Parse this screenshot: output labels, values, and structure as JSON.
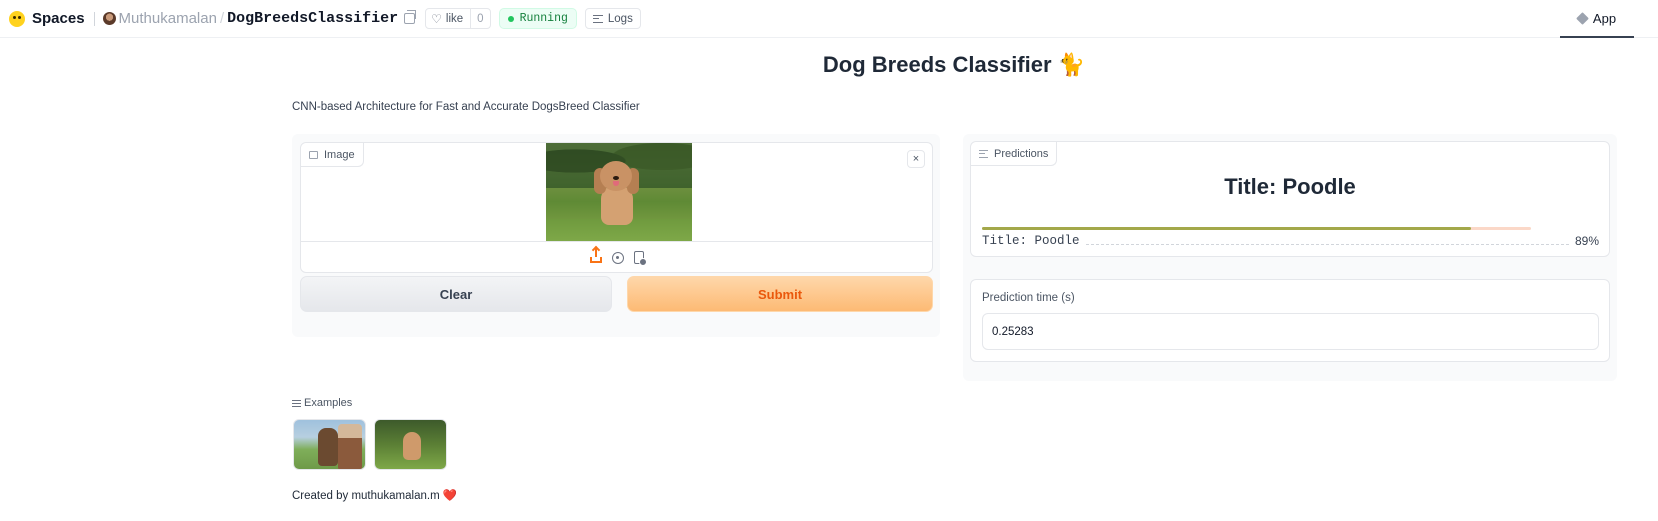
{
  "topbar": {
    "spaces_label": "Spaces",
    "owner": "Muthukamalan",
    "repo": "DogBreedsClassifier",
    "like_label": "like",
    "like_count": "0",
    "status": "Running",
    "logs_label": "Logs",
    "app_tab": "App"
  },
  "page": {
    "title": "Dog Breeds Classifier",
    "title_emoji": "🐈",
    "description": "CNN-based Architecture for Fast and Accurate DogsBreed Classifier"
  },
  "input": {
    "image_label": "Image",
    "clear_x": "×",
    "clear_button": "Clear",
    "submit_button": "Submit"
  },
  "output": {
    "predictions_label": "Predictions",
    "top_label": "Title: Poodle",
    "confidences": [
      {
        "label": "Title: Poodle",
        "value": 0.89,
        "display": "89%"
      }
    ],
    "time_label": "Prediction time (s)",
    "time_value": "0.25283"
  },
  "examples": {
    "label": "Examples",
    "items": [
      "example-1",
      "example-2"
    ]
  },
  "footer": {
    "credits_text": "Created by muthukamalan.m",
    "credits_heart": "❤️"
  },
  "colors": {
    "accent": "#f97316",
    "status_green": "#22c55e",
    "confidence_bar": "#a3a84a"
  }
}
